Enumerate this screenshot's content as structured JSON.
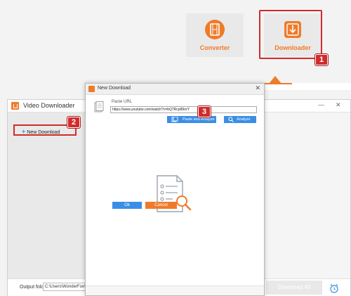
{
  "launcher": {
    "converter_label": "Converter",
    "downloader_label": "Downloader",
    "accent_color": "#ef7b2a"
  },
  "steps": [
    "1",
    "2",
    "3"
  ],
  "video_downloader": {
    "title": "Video Downloader",
    "new_download_label": "New Download",
    "output_folder_label": "Output folder:",
    "output_folder_value": "C:\\Users\\WonderFox\\Documents",
    "download_all_label": "Download All"
  },
  "new_download_dialog": {
    "title": "New Download",
    "paste_url_label": "Paste URL",
    "url_value": "https://www.youtube.com/watch?v=bQ7Rcp89orY",
    "paste_and_analyze_label": "Paste and Analyze",
    "analyze_label": "Analyze",
    "ok_label": "Ok",
    "cancel_label": "Cancel"
  },
  "colors": {
    "accent_orange": "#ef7b2a",
    "button_blue": "#3a8ee6",
    "highlight_red": "#d12b2b"
  }
}
